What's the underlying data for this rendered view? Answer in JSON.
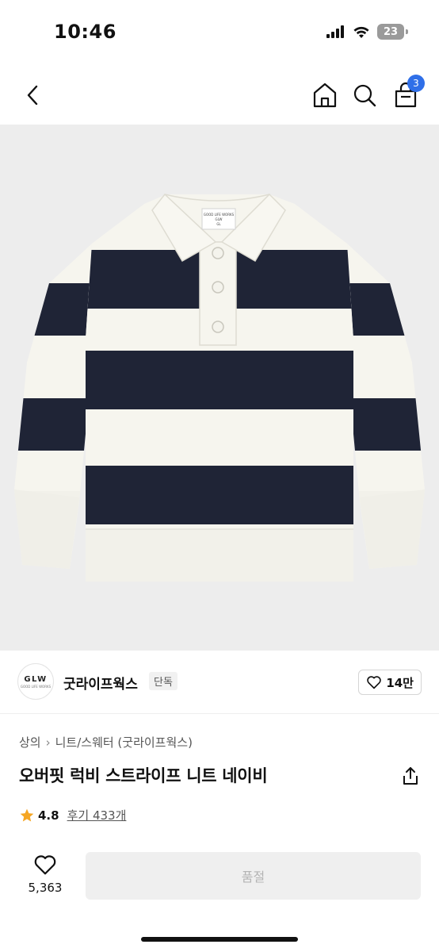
{
  "status_bar": {
    "time": "10:46",
    "battery": "23",
    "icons": [
      "signal-icon",
      "wifi-icon",
      "battery-icon"
    ]
  },
  "nav": {
    "cart_count": "3",
    "icons": [
      "back-chevron-icon",
      "home-icon",
      "search-icon",
      "cart-bag-icon"
    ]
  },
  "product_image": {
    "label_lines": [
      "GOOD LIFE WORKS",
      "GLW",
      "GL"
    ],
    "colors": {
      "navy": "#1f2436",
      "cream": "#f6f5ee",
      "background": "#ededed"
    }
  },
  "brand": {
    "logo_text": "GLW",
    "logo_subtext": "GOOD LIFE WORKS",
    "name": "굿라이프웍스",
    "tag": "단독",
    "likes": "14만"
  },
  "breadcrumb": [
    "상의",
    "니트/스웨터 (굿라이프웍스)"
  ],
  "product": {
    "title": "오버핏 럭비 스트라이프 니트 네이비",
    "rating": "4.8",
    "reviews": "후기 433개"
  },
  "bottom_bar": {
    "wish_count": "5,363",
    "button_label": "품절"
  },
  "colors": {
    "accent_badge": "#2f6fe8",
    "star": "#f5a623",
    "disabled_button": "#efefef"
  }
}
